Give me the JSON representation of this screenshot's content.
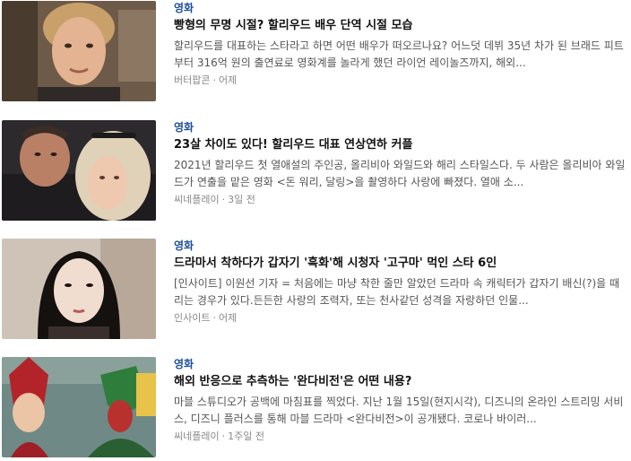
{
  "feed": {
    "items": [
      {
        "category": "영화",
        "title": "빵형의 무명 시절? 할리우드 배우 단역 시절 모습",
        "summary": "할리우드를 대표하는 스타라고 하면 어떤 배우가 떠오르나요? 어느덧 데뷔 35년 차가 된 브래드 피트부터 316억 원의 출연료로 영화계를 놀라게 했던 라이언 레이놀즈까지, 해외...",
        "source": "버터팝콘",
        "time": "어제",
        "thumb_alt": "young actor portrait"
      },
      {
        "category": "영화",
        "title": "23살 차이도 있다! 할리우드 대표 연상연하 커플",
        "summary": "2021년 할리우드 첫 열애설의 주인공, 올리비아 와일드와 해리 스타일스다. 두 사람은 올리비아 와일드가 연출을 맡은 영화 <돈 워리, 달링>을 촬영하다 사랑에 빠졌다. 열애 소...",
        "source": "씨네플레이",
        "time": "3일 전",
        "thumb_alt": "couple selfie"
      },
      {
        "category": "영화",
        "title": "드라마서 착하다가 갑자기 '흑화'해 시청자 '고구마' 먹인 스타 6인",
        "summary": "[인사이트] 이원선 기자 = 처음에는 마냥 착한 줄만 알았던 드라마 속 캐릭터가 갑자기 배신(?)을 때리는 경우가 있다.든든한 사랑의 조력자, 또는 천사같던 성격을 자랑하던 인물...",
        "source": "인사이트",
        "time": "어제",
        "thumb_alt": "actress portrait"
      },
      {
        "category": "영화",
        "title": "해외 반응으로 추측하는 '완다비전'은 어떤 내용?",
        "summary": "마블 스튜디오가 공백에 마침표를 찍었다. 지난 1월 15일(현지시각), 디즈니의 온라인 스트리밍 서비스, 디즈니 플러스를 통해 마블 드라마 <완다비전>이 공개됐다. 코로나 바이러...",
        "source": "씨네플레이",
        "time": "1주일 전",
        "thumb_alt": "costumed heroes"
      }
    ]
  },
  "colors": {
    "category": "#1f4f9a",
    "title": "#111111",
    "summary": "#555555",
    "meta": "#888888"
  }
}
